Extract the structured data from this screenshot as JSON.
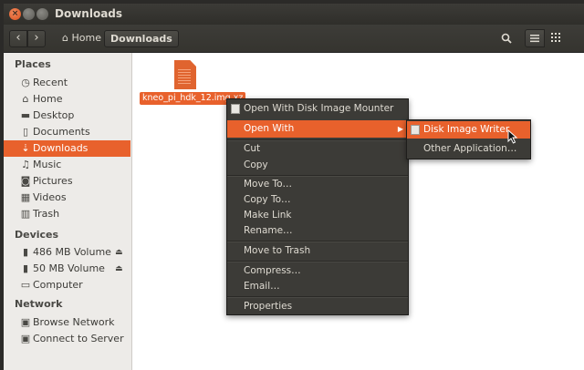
{
  "window": {
    "title": "Downloads"
  },
  "toolbar": {
    "back_icon": "chevron-left-icon",
    "forward_icon": "chevron-right-icon",
    "home_label": "Home",
    "current_label": "Downloads"
  },
  "sidebar": {
    "places_heading": "Places",
    "places": [
      {
        "label": "Recent",
        "icon": "clock-icon"
      },
      {
        "label": "Home",
        "icon": "home-icon"
      },
      {
        "label": "Desktop",
        "icon": "folder-icon"
      },
      {
        "label": "Documents",
        "icon": "document-icon"
      },
      {
        "label": "Downloads",
        "icon": "download-icon"
      },
      {
        "label": "Music",
        "icon": "music-icon"
      },
      {
        "label": "Pictures",
        "icon": "camera-icon"
      },
      {
        "label": "Videos",
        "icon": "film-icon"
      },
      {
        "label": "Trash",
        "icon": "trash-icon"
      }
    ],
    "devices_heading": "Devices",
    "devices": [
      {
        "label": "486 MB Volume",
        "icon": "drive-icon"
      },
      {
        "label": "50 MB Volume",
        "icon": "drive-icon"
      },
      {
        "label": "Computer",
        "icon": "computer-icon"
      }
    ],
    "network_heading": "Network",
    "network": [
      {
        "label": "Browse Network",
        "icon": "network-icon"
      },
      {
        "label": "Connect to Server",
        "icon": "server-icon"
      }
    ]
  },
  "file": {
    "name": "kneo_pi_hdk_12.img.xz"
  },
  "context_menu": {
    "items": [
      "Open With Disk Image Mounter",
      "Open With",
      "Cut",
      "Copy",
      "Move To…",
      "Copy To…",
      "Make Link",
      "Rename…",
      "Move to Trash",
      "Compress…",
      "Email…",
      "Properties"
    ]
  },
  "submenu": {
    "items": [
      "Disk Image Writer",
      "Other Application…"
    ]
  },
  "colors": {
    "accent": "#e8612c",
    "menu_bg": "#3c3b37",
    "title_bg": "#3c3b37"
  }
}
